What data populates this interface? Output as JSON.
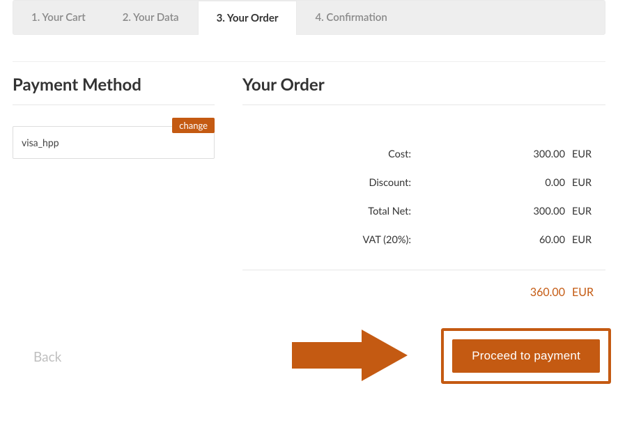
{
  "tabs": [
    {
      "label": "1. Your Cart"
    },
    {
      "label": "2. Your Data"
    },
    {
      "label": "3. Your Order"
    },
    {
      "label": "4. Confirmation"
    }
  ],
  "activeTabIndex": 2,
  "left": {
    "heading": "Payment Method",
    "change_label": "change",
    "payment_method_value": "visa_hpp"
  },
  "right": {
    "heading": "Your Order",
    "lines": [
      {
        "label": "Cost:",
        "value": "300.00",
        "currency": "EUR"
      },
      {
        "label": "Discount:",
        "value": "0.00",
        "currency": "EUR"
      },
      {
        "label": "Total Net:",
        "value": "300.00",
        "currency": "EUR"
      },
      {
        "label": "VAT (20%):",
        "value": "60.00",
        "currency": "EUR"
      }
    ],
    "total": {
      "value": "360.00",
      "currency": "EUR"
    }
  },
  "actions": {
    "back_label": "Back",
    "proceed_label": "Proceed to payment"
  },
  "colors": {
    "accent": "#c45a12"
  }
}
